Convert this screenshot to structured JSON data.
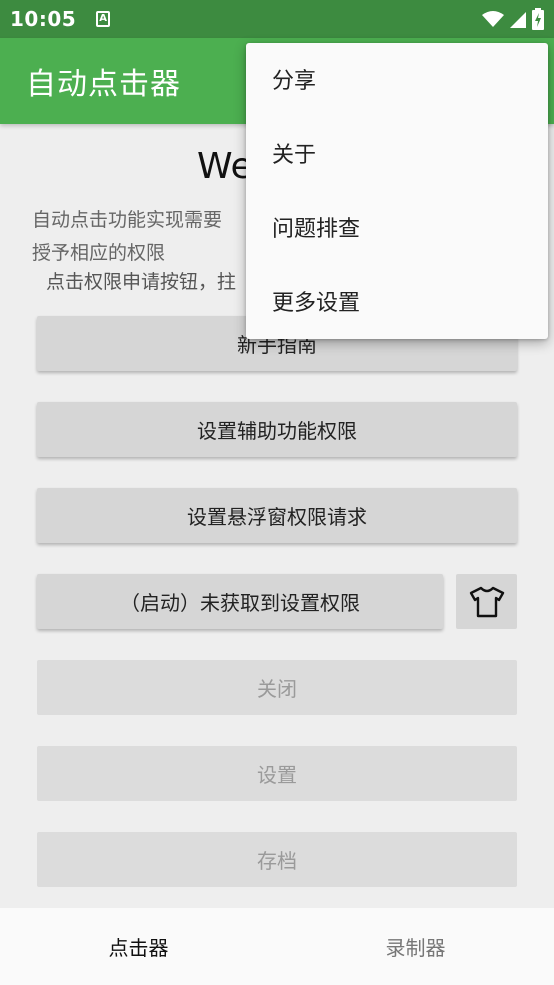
{
  "status_bar": {
    "time": "10:05",
    "a_badge": "A"
  },
  "app_bar": {
    "title": "自动点击器"
  },
  "main": {
    "welcome": "We",
    "desc_line1": "自动点击功能实现需要",
    "desc_line2": "授予相应的权限",
    "desc_line3": "点击权限申请按钮，拄"
  },
  "buttons": {
    "guide": "新手指南",
    "accessibility": "设置辅助功能权限",
    "overlay": "设置悬浮窗权限请求",
    "start": "（启动）未获取到设置权限",
    "close": "关闭",
    "settings": "设置",
    "save": "存档"
  },
  "menu": {
    "items": [
      {
        "label": "分享"
      },
      {
        "label": "关于"
      },
      {
        "label": "问题排查"
      },
      {
        "label": "更多设置"
      }
    ]
  },
  "bottom_nav": {
    "clicker": "点击器",
    "recorder": "录制器"
  },
  "colors": {
    "status_bar": "#3d8b40",
    "app_bar": "#4caf50"
  }
}
